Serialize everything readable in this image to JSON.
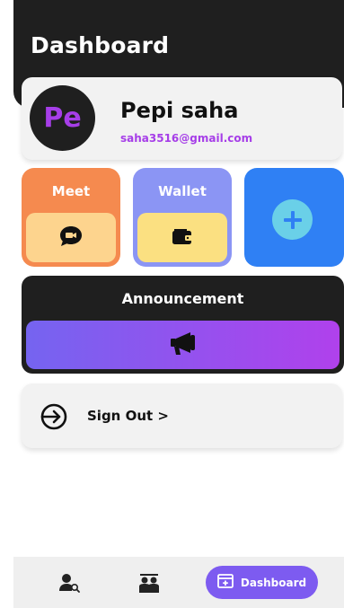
{
  "header": {
    "title": "Dashboard"
  },
  "profile": {
    "initials": "Pe",
    "name": "Pepi saha",
    "email": "saha3516@gmail.com"
  },
  "tiles": {
    "meet": {
      "label": "Meet",
      "icon": "video-chat-icon"
    },
    "wallet": {
      "label": "Wallet",
      "icon": "wallet-icon"
    },
    "add": {
      "icon": "plus-circle-icon"
    }
  },
  "announcement": {
    "title": "Announcement",
    "icon": "megaphone-icon"
  },
  "signout": {
    "label": "Sign Out >",
    "icon": "sign-out-icon"
  },
  "bottom_nav": {
    "items": [
      {
        "icon": "user-search-icon"
      },
      {
        "icon": "people-icon"
      },
      {
        "icon": "dashboard-icon",
        "label": "Dashboard",
        "active": true
      }
    ]
  },
  "colors": {
    "accent": "#a63ee8",
    "meet": "#f58a4f",
    "wallet": "#8b95f4",
    "add": "#2f80f4",
    "nav_active": "#7d5bf0"
  }
}
